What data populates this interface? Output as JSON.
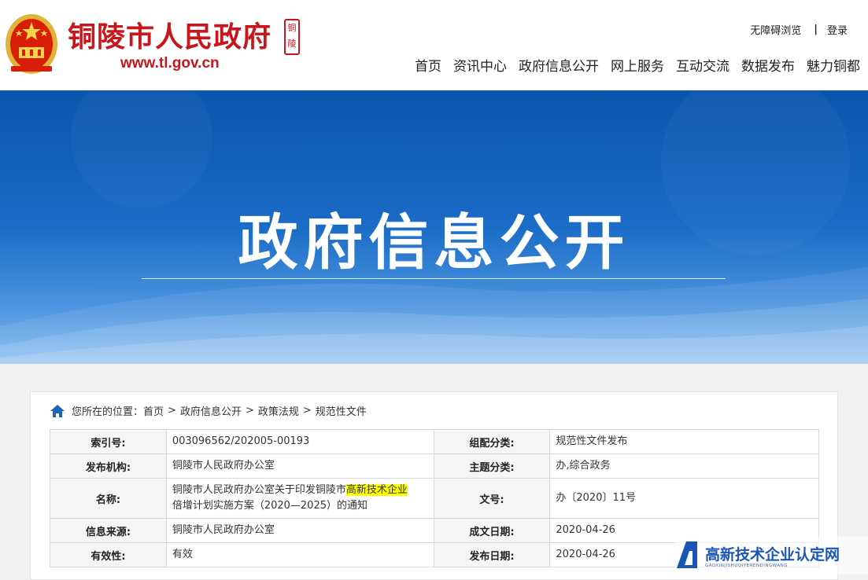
{
  "header": {
    "site_name": "铜陵市人民政府",
    "site_url": "www.tl.gov.cn",
    "seal_text": "铜陵",
    "accessibility_link": "无障碍浏览",
    "separator": "|",
    "login_link": "登录",
    "nav": [
      "首页",
      "资讯中心",
      "政府信息公开",
      "网上服务",
      "互动交流",
      "数据发布",
      "魅力铜都"
    ]
  },
  "banner": {
    "title": "政府信息公开"
  },
  "breadcrumb": {
    "prefix": "您所在的位置：",
    "items": [
      "首页",
      "政府信息公开",
      "政策法规",
      "规范性文件"
    ],
    "arrow": ">"
  },
  "info_table": {
    "index_label": "索引号:",
    "index_value": "003096562/202005-00193",
    "category_label": "组配分类:",
    "category_value": "规范性文件发布",
    "publisher_label": "发布机构:",
    "publisher_value": "铜陵市人民政府办公室",
    "topic_label": "主题分类:",
    "topic_value": "办,综合政务",
    "name_label": "名称:",
    "name_value_part1": "铜陵市人民政府办公室关于印发铜陵市",
    "name_value_highlight": "高新技术企业",
    "name_value_part2": "倍增计划实施方案（2020—2025）的通知",
    "docno_label": "文号:",
    "docno_value": "办〔2020〕11号",
    "source_label": "信息来源:",
    "source_value": "铜陵市人民政府办公室",
    "created_label": "成文日期:",
    "created_value": "2020-04-26",
    "validity_label": "有效性:",
    "validity_value": "有效",
    "published_label": "发布日期:",
    "published_value": "2020-04-26"
  },
  "watermark": {
    "title": "高新技术企业认定网",
    "subtitle": "GAOXINJISHUQIYERENDINGWANG"
  },
  "colors": {
    "brand_red": "#c8161d",
    "banner_blue": "#0b55ad",
    "highlight": "#ffff00",
    "watermark_blue": "#1a55b8"
  }
}
